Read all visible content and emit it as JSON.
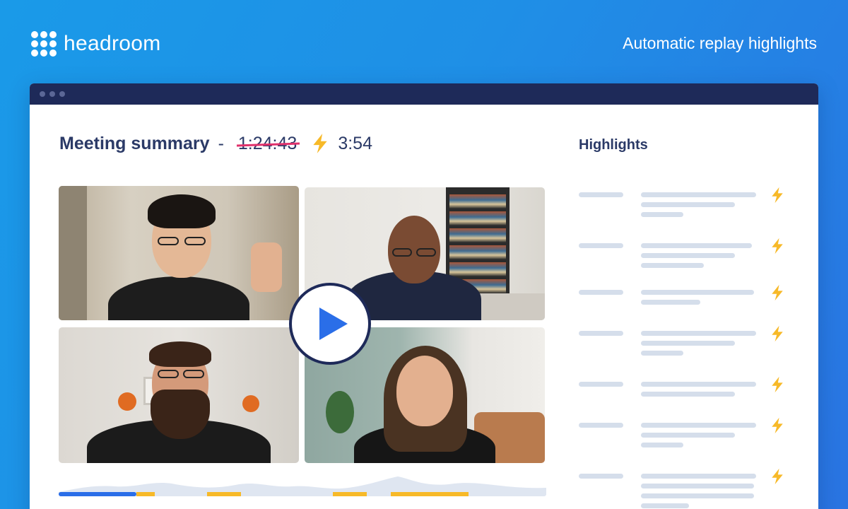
{
  "brand": {
    "name": "headroom"
  },
  "tagline": "Automatic replay highlights",
  "meeting": {
    "title": "Meeting summary",
    "separator": "-",
    "original_duration": "1:24:43",
    "highlight_duration": "3:54",
    "bolt_icon": "lightning-bolt-icon"
  },
  "highlights": {
    "title": "Highlights",
    "count": 7,
    "bolt_icon": "lightning-bolt-icon"
  },
  "colors": {
    "accent_blue": "#2a6ee8",
    "highlight_yellow": "#f7b928",
    "strike_pink": "#e0316b",
    "navy": "#2b3a67"
  },
  "participants": [
    {
      "id": "participant-1"
    },
    {
      "id": "participant-2"
    },
    {
      "id": "participant-3"
    },
    {
      "id": "participant-4"
    }
  ],
  "player": {
    "play_icon": "play-icon"
  }
}
